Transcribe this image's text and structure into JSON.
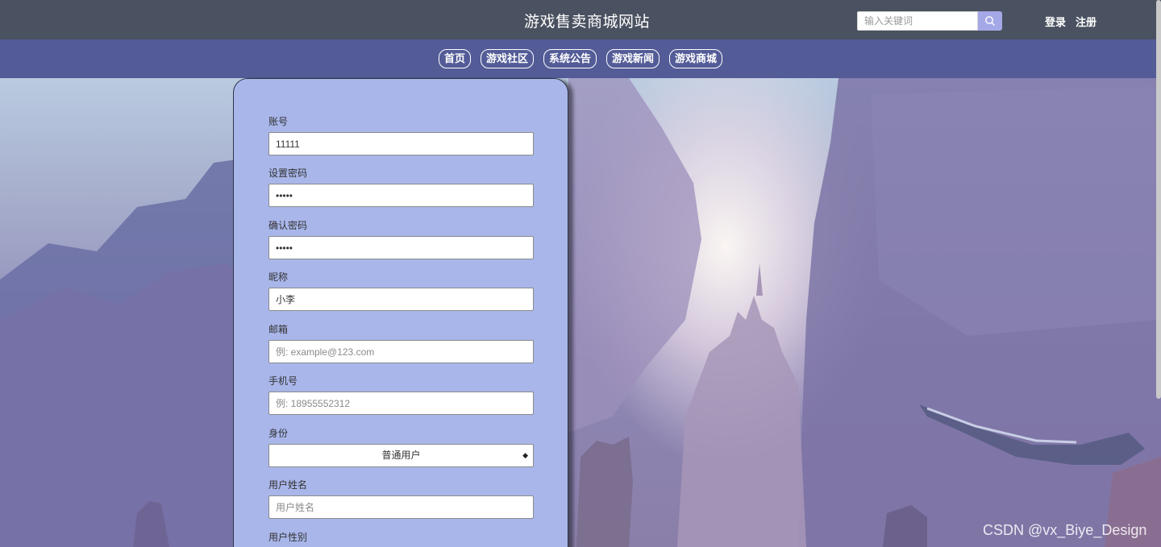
{
  "header": {
    "site_title": "游戏售卖商城网站",
    "search_placeholder": "输入关键词",
    "login_label": "登录",
    "register_label": "注册"
  },
  "nav": {
    "items": [
      "首页",
      "游戏社区",
      "系统公告",
      "游戏新闻",
      "游戏商城"
    ]
  },
  "form": {
    "account": {
      "label": "账号",
      "value": "11111"
    },
    "password": {
      "label": "设置密码",
      "value": "11111"
    },
    "confirm_password": {
      "label": "确认密码",
      "value": "11111"
    },
    "nickname": {
      "label": "昵称",
      "value": "小李"
    },
    "email": {
      "label": "邮箱",
      "placeholder": "例: example@123.com"
    },
    "phone": {
      "label": "手机号",
      "placeholder": "例: 18955552312"
    },
    "role": {
      "label": "身份",
      "selected": "普通用户"
    },
    "real_name": {
      "label": "用户姓名",
      "placeholder": "用户姓名"
    },
    "gender": {
      "label": "用户性别"
    }
  },
  "watermark": "CSDN @vx_Biye_Design",
  "colors": {
    "header_bg": "#4a5160",
    "nav_bg": "#535c97",
    "panel_bg": "#a9b6ea",
    "search_button": "#a5a8e6"
  },
  "icons": {
    "search_button": "search-icon",
    "select_arrow": "up-down-arrow-icon"
  }
}
